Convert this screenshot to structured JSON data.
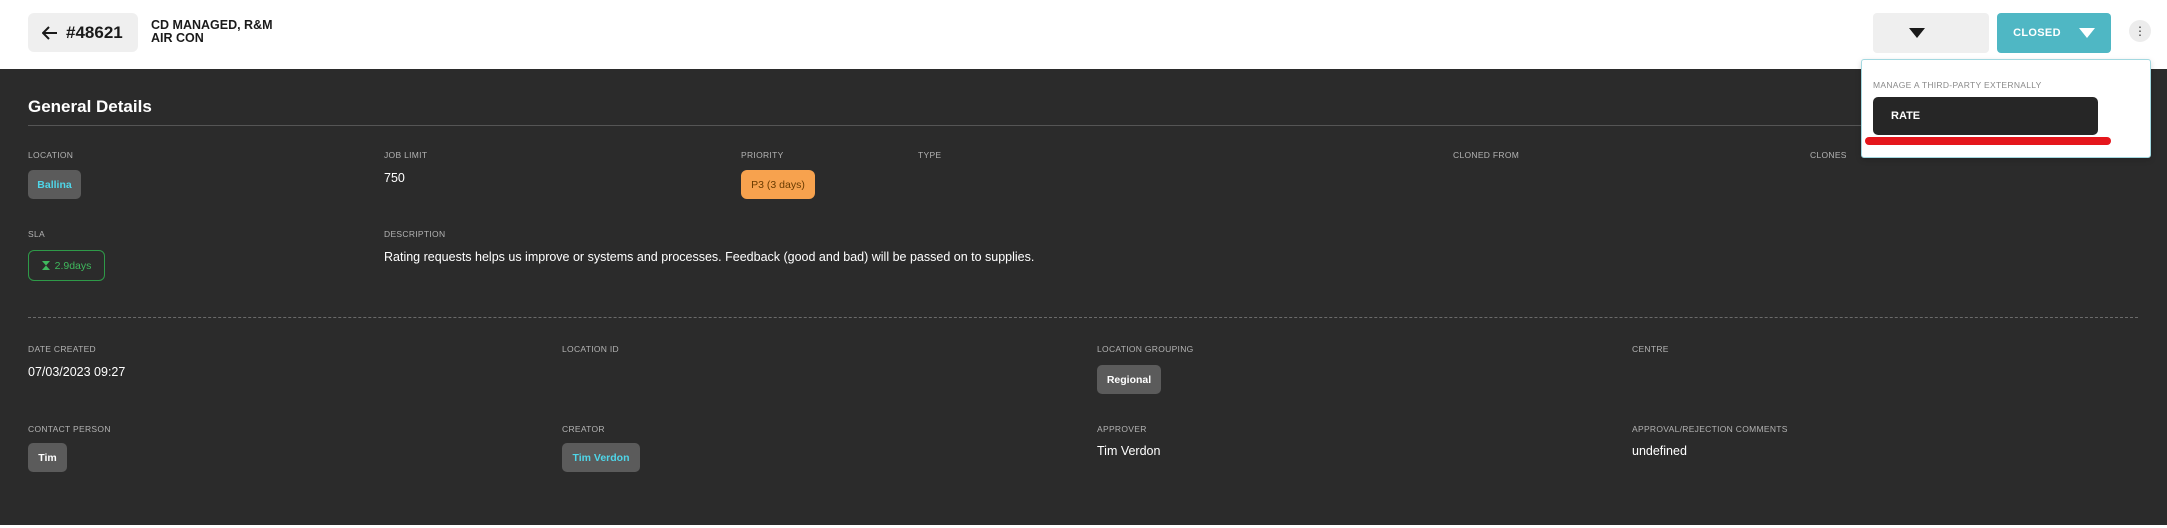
{
  "header": {
    "job_number": "#48621",
    "job_title_line1": "CD MANAGED, R&M",
    "job_title_line2": "AIR CON",
    "status_label": "CLOSED",
    "more_symbol": "⋮"
  },
  "popup": {
    "label": "MANAGE A THIRD-PARTY EXTERNALLY",
    "rate_label": "RATE"
  },
  "section": {
    "title": "General Details",
    "collapse_symbol": "—"
  },
  "fields": {
    "location_label": "LOCATION",
    "location_value": "Ballina",
    "job_limit_label": "JOB LIMIT",
    "job_limit_value": "750",
    "priority_label": "PRIORITY",
    "priority_value": "P3 (3 days)",
    "type_label": "TYPE",
    "cloned_from_label": "CLONED FROM",
    "clones_label": "CLONES",
    "sla_label": "SLA",
    "sla_value": "2.9days",
    "description_label": "DESCRIPTION",
    "description_value": "Rating requests helps us improve or systems and processes. Feedback (good and bad) will be passed on to supplies.",
    "date_created_label": "DATE CREATED",
    "date_created_value": "07/03/2023 09:27",
    "location_id_label": "LOCATION ID",
    "location_grouping_label": "LOCATION GROUPING",
    "location_grouping_value": "Regional",
    "centre_label": "CENTRE",
    "contact_person_label": "CONTACT PERSON",
    "contact_person_value": "Tim",
    "creator_label": "CREATOR",
    "creator_value": "Tim Verdon",
    "approver_label": "APPROVER",
    "approver_value": "Tim Verdon",
    "approval_comments_label": "APPROVAL/REJECTION COMMENTS",
    "approval_comments_value": "undefined"
  },
  "colors": {
    "accent": "#4fb7c4",
    "panel_bg": "#2b2b2b",
    "priority_orange": "#f7a24e",
    "sla_green": "#3fb95d",
    "highlight_red": "#e5161c"
  }
}
